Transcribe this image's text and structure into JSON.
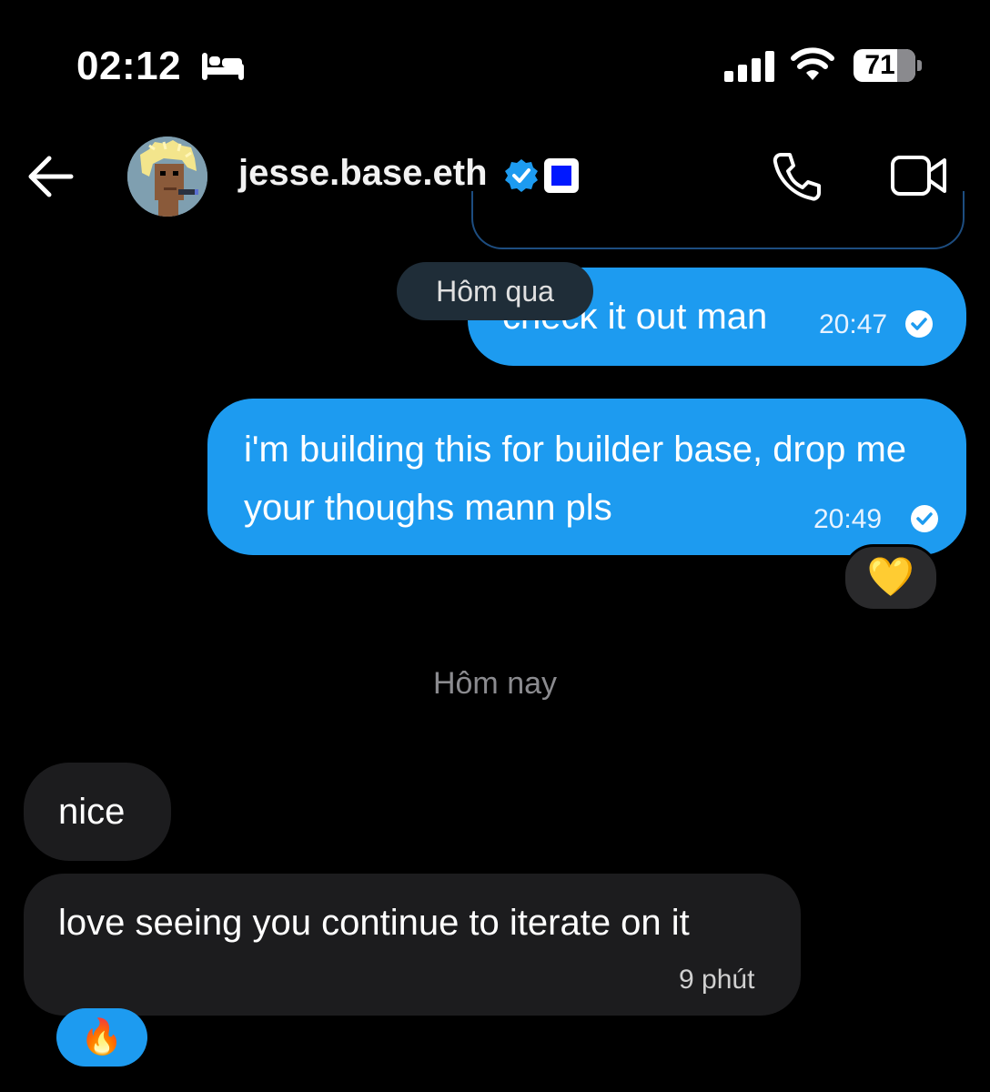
{
  "status_bar": {
    "time": "02:12",
    "battery": "71",
    "sleep_icon": "bed-icon",
    "signal_icon": "cellular-signal-icon",
    "wifi_icon": "wifi-icon"
  },
  "header": {
    "back_icon": "back-arrow-icon",
    "contact_name": "jesse.base.eth",
    "verified_icon": "verified-badge-icon",
    "call_icon": "phone-icon",
    "video_icon": "video-camera-icon"
  },
  "conversation": {
    "date_yesterday": "Hôm qua",
    "date_today": "Hôm nay",
    "outgoing": [
      {
        "text": "check it out man",
        "time": "20:47"
      },
      {
        "text": "i'm building this for builder base, drop me your thoughs mann pls",
        "time": "20:49",
        "reaction": "💛"
      }
    ],
    "incoming": [
      {
        "text": "nice"
      },
      {
        "text": "love seeing you continue to iterate on it",
        "time": "9 phút",
        "reaction": "🔥"
      }
    ]
  },
  "colors": {
    "outgoing_bubble": "#1d9bf0",
    "incoming_bubble": "#1c1c1e",
    "background": "#000000"
  }
}
